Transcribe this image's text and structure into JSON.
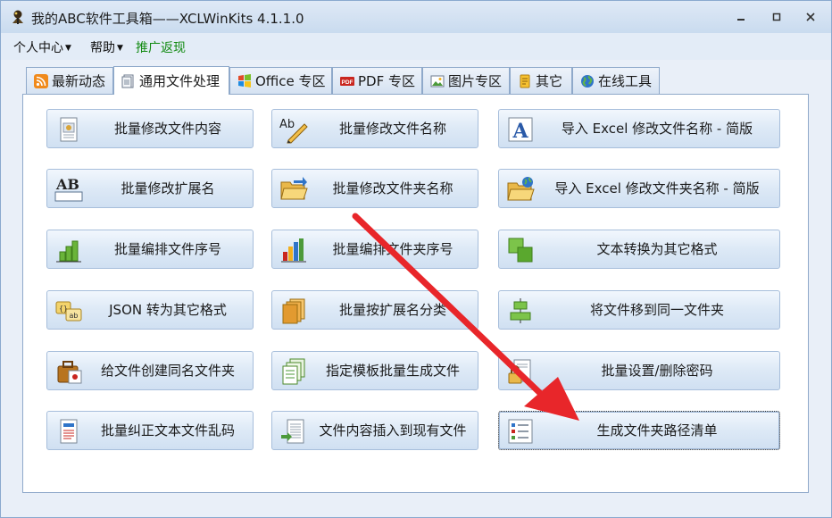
{
  "window": {
    "title": "我的ABC软件工具箱——XCLWinKits  4.1.1.0",
    "controls": {
      "minimize": "▁",
      "maximize": "▢",
      "close": "✕"
    }
  },
  "menu": {
    "items": [
      {
        "label": "个人中心",
        "has_dropdown": true
      },
      {
        "label": "帮助",
        "has_dropdown": true
      },
      {
        "label": "推广返现",
        "has_dropdown": false,
        "color": "#118a11"
      }
    ]
  },
  "tabs": [
    {
      "label": "最新动态",
      "icon": "rss-icon",
      "active": false
    },
    {
      "label": "通用文件处理",
      "icon": "document-icon",
      "active": true
    },
    {
      "label": "Office 专区",
      "icon": "office-logo-icon",
      "active": false
    },
    {
      "label": "PDF 专区",
      "icon": "pdf-icon",
      "active": false
    },
    {
      "label": "图片专区",
      "icon": "picture-icon",
      "active": false
    },
    {
      "label": "其它",
      "icon": "note-icon",
      "active": false
    },
    {
      "label": "在线工具",
      "icon": "globe-icon",
      "active": false
    }
  ],
  "tools": [
    {
      "label": "批量修改文件内容",
      "icon": "document-edit-icon"
    },
    {
      "label": "批量修改文件名称",
      "icon": "ab-pencil-icon"
    },
    {
      "label": "导入 Excel 修改文件名称 - 简版",
      "icon": "letter-a-icon"
    },
    {
      "label": "批量修改扩展名",
      "icon": "ab-box-icon"
    },
    {
      "label": "批量修改文件夹名称",
      "icon": "folder-open-icon"
    },
    {
      "label": "导入 Excel 修改文件夹名称 - 简版",
      "icon": "folder-globe-icon"
    },
    {
      "label": "批量编排文件序号",
      "icon": "green-bars-icon"
    },
    {
      "label": "批量编排文件夹序号",
      "icon": "color-bars-icon"
    },
    {
      "label": "文本转换为其它格式",
      "icon": "green-squares-icon"
    },
    {
      "label": "JSON 转为其它格式",
      "icon": "json-convert-icon"
    },
    {
      "label": "批量按扩展名分类",
      "icon": "stacked-files-icon"
    },
    {
      "label": "将文件移到同一文件夹",
      "icon": "align-move-icon"
    },
    {
      "label": "给文件创建同名文件夹",
      "icon": "briefcase-icon"
    },
    {
      "label": "指定模板批量生成文件",
      "icon": "template-files-icon"
    },
    {
      "label": "批量设置/删除密码",
      "icon": "lock-document-icon"
    },
    {
      "label": "批量纠正文本文件乱码",
      "icon": "text-fix-icon"
    },
    {
      "label": "文件内容插入到现有文件",
      "icon": "insert-document-icon"
    },
    {
      "label": "生成文件夹路径清单",
      "icon": "checklist-icon",
      "selected": true
    }
  ],
  "annotation": {
    "arrow_color": "#e8262a"
  }
}
